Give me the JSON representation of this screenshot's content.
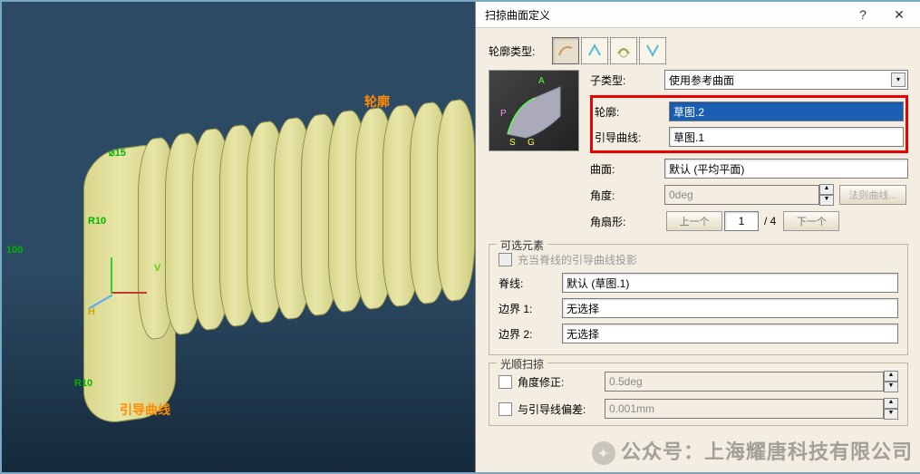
{
  "viewport": {
    "dim_height": "100",
    "dim_r10_1": "R10",
    "dim_r10_2": "R10",
    "dim_d15": "⌀15",
    "label_profile": "轮廓",
    "label_guide": "引导曲线",
    "h_label": "H",
    "v_label": "V"
  },
  "dialog": {
    "title": "扫掠曲面定义",
    "profile_type_label": "轮廓类型:",
    "subtype_label": "子类型:",
    "subtype_value": "使用参考曲面",
    "profile_label": "轮廓:",
    "profile_value": "草图.2",
    "guide_label": "引导曲线:",
    "guide_value": "草图.1",
    "surface_label": "曲面:",
    "surface_value": "默认 (平均平面)",
    "angle_label": "角度:",
    "angle_value": "0deg",
    "law_btn": "法则曲线...",
    "angle_sector_label": "角扇形:",
    "prev_btn": "上一个",
    "sector_value": "1",
    "sector_total": "/ 4",
    "next_btn": "下一个",
    "optional_section": "可选元素",
    "proj_checkbox": "充当脊线的引导曲线投影",
    "spine_label": "脊线:",
    "spine_value": "默认 (草图.1)",
    "boundary1_label": "边界 1:",
    "boundary1_value": "无选择",
    "boundary2_label": "边界 2:",
    "boundary2_value": "无选择",
    "smooth_section": "光顺扫掠",
    "angle_corr_label": "角度修正:",
    "angle_corr_value": "0.5deg",
    "guide_dev_label": "与引导线偏差:",
    "guide_dev_value": "0.001mm"
  },
  "watermark": "公众号：上海耀唐科技有限公司"
}
